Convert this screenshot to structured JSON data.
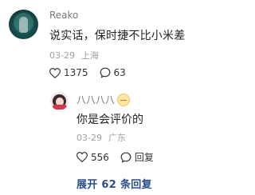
{
  "comment": {
    "username": "Reako",
    "text": "说实话，保时捷不比小米差",
    "date": "03-29",
    "location": "上海",
    "likes": "1375",
    "replies": "63"
  },
  "reply": {
    "username": "八八八八",
    "text": "你是会评价的",
    "date": "03-29",
    "location": "广东",
    "likes": "556",
    "reply_label": "回复"
  },
  "expand": {
    "label": "展开 62 条回复"
  },
  "colors": {
    "link": "#2a4e8a",
    "muted": "#a0a0a0"
  }
}
